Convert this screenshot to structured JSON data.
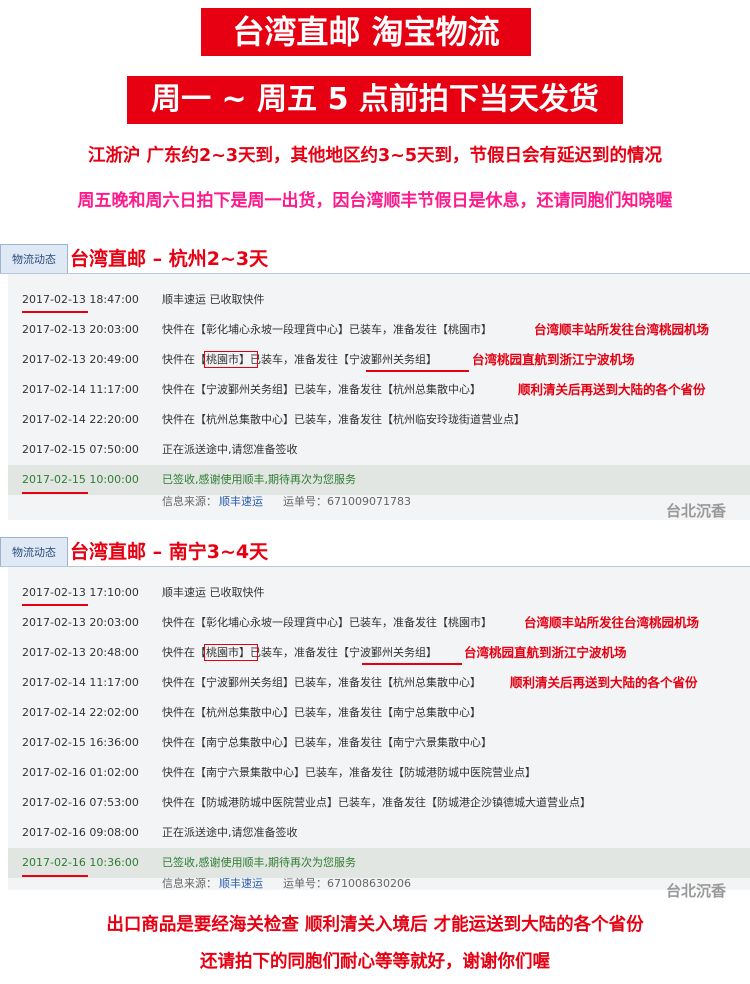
{
  "banner1": "台湾直邮 淘宝物流",
  "banner2": "周一 ~ 周五  5 点前拍下当天发货",
  "notice1": "江浙沪 广东约2~3天到，其他地区约3~5天到，节假日会有延迟到的情况",
  "notice2": "周五晚和周六日拍下是周一出货，因台湾顺丰节假日是休息，还请同胞们知晓喔",
  "tab_label": "物流动态",
  "sections": [
    {
      "title": "台湾直邮 – 杭州2~3天",
      "rows": [
        {
          "time": "2017-02-13 18:47:00",
          "desc": "顺丰速运 已收取快件",
          "note": ""
        },
        {
          "time": "2017-02-13 20:03:00",
          "desc": "快件在【彰化埔心永坡一段理貨中心】已装车，准备发往【桃園市】",
          "note": "台湾顺丰站所发往台湾桃园机场"
        },
        {
          "time": "2017-02-13 20:49:00",
          "desc": "快件在【桃園市】已装车，准备发往【宁波鄞州关务组】",
          "note": "台湾桃园直航到浙江宁波机场"
        },
        {
          "time": "2017-02-14 11:17:00",
          "desc": "快件在【宁波鄞州关务组】已装车，准备发往【杭州总集散中心】",
          "note": "顺利清关后再送到大陆的各个省份"
        },
        {
          "time": "2017-02-14 22:20:00",
          "desc": "快件在【杭州总集散中心】已装车，准备发往【杭州临安玲珑街道营业点】",
          "note": ""
        },
        {
          "time": "2017-02-15 07:50:00",
          "desc": "正在派送途中,请您准备签收",
          "note": ""
        },
        {
          "time": "2017-02-15 10:00:00",
          "desc": "已签收,感谢使用顺丰,期待再次为您服务",
          "note": ""
        }
      ],
      "source_label": "信息来源：",
      "source_value": "顺丰速运",
      "waybill_label": "运单号：",
      "waybill_value": "671009071783",
      "watermark": "台北沉香"
    },
    {
      "title": "台湾直邮 – 南宁3~4天",
      "rows": [
        {
          "time": "2017-02-13 17:10:00",
          "desc": "顺丰速运 已收取快件",
          "note": ""
        },
        {
          "time": "2017-02-13 20:03:00",
          "desc": "快件在【彰化埔心永坡一段理貨中心】已装车，准备发往【桃園市】",
          "note": "台湾顺丰站所发往台湾桃园机场"
        },
        {
          "time": "2017-02-13 20:48:00",
          "desc": "快件在【桃園市】已装车，准备发往【宁波鄞州关务组】",
          "note": "台湾桃园直航到浙江宁波机场"
        },
        {
          "time": "2017-02-14 11:17:00",
          "desc": "快件在【宁波鄞州关务组】已装车，准备发往【杭州总集散中心】",
          "note": "顺利清关后再送到大陆的各个省份"
        },
        {
          "time": "2017-02-14 22:02:00",
          "desc": "快件在【杭州总集散中心】已装车，准备发往【南宁总集散中心】",
          "note": ""
        },
        {
          "time": "2017-02-15 16:36:00",
          "desc": "快件在【南宁总集散中心】已装车，准备发往【南宁六景集散中心】",
          "note": ""
        },
        {
          "time": "2017-02-16 01:02:00",
          "desc": "快件在【南宁六景集散中心】已装车，准备发往【防城港防城中医院营业点】",
          "note": ""
        },
        {
          "time": "2017-02-16 07:53:00",
          "desc": "快件在【防城港防城中医院营业点】已装车，准备发往【防城港企沙镇德城大道营业点】",
          "note": ""
        },
        {
          "time": "2017-02-16 09:08:00",
          "desc": "正在派送途中,请您准备签收",
          "note": ""
        },
        {
          "time": "2017-02-16 10:36:00",
          "desc": "已签收,感谢使用顺丰,期待再次为您服务",
          "note": ""
        }
      ],
      "source_label": "信息来源：",
      "source_value": "顺丰速运",
      "waybill_label": "运单号：",
      "waybill_value": "671008630206",
      "watermark": "台北沉香"
    }
  ],
  "footer1": "出口商品是要经海关检查 顺利清关入境后 才能运送到大陆的各个省份",
  "footer2": "还请拍下的同胞们耐心等等就好，谢谢你们喔",
  "colors": {
    "accent_red": "#e60012",
    "accent_pink": "#ff1a8c",
    "delivered_green": "#2e7d32",
    "link_blue": "#2a5db0"
  }
}
